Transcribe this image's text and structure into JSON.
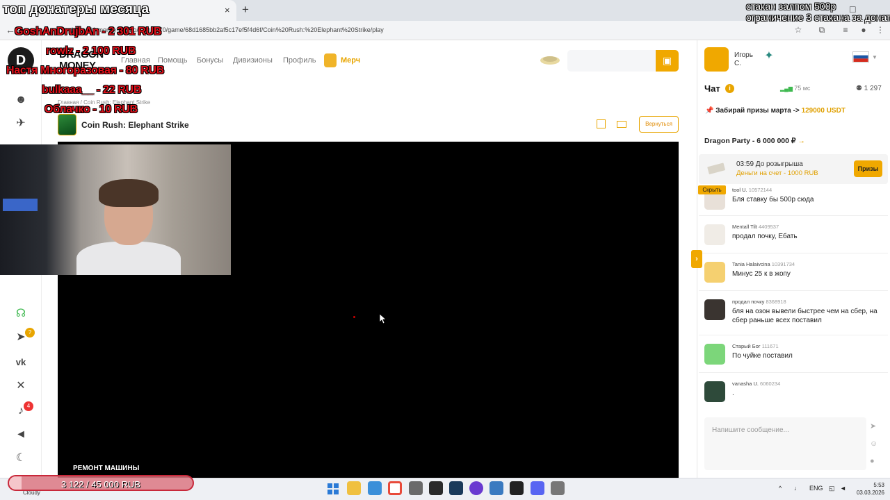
{
  "browser": {
    "new_tab_symbol": "+",
    "close_symbol": "×",
    "url": "dragon21.money-casino/games/70/game/68d1685bb2af5c17ef5f4d6f/Coin%20Rush:%20Elephant%20Strike/play",
    "window_controls": [
      "–",
      "□",
      "×"
    ]
  },
  "site": {
    "logo_text": "DRAGON\nMONEY",
    "nav": [
      "Главная",
      "Помощь",
      "Бонусы",
      "Дивизионы",
      "Профиль"
    ],
    "merch_label": "Мерч",
    "breadcrumb": "Главная / Coin Rush: Elephant Strike",
    "game_title": "Coin Rush: Elephant Strike",
    "return_label": "Вернуться",
    "notification_count": "4",
    "telegram_badge": "?"
  },
  "chat": {
    "user_name": "Игорь\nС.",
    "title": "Чат",
    "ping": "75 мс",
    "online": "1 297",
    "promo_text": "Забирай призы марта ->",
    "promo_amount": "129000 USDT",
    "party": "Dragon Party - 6 000 000 ₽",
    "raffle_time": "03:59 До розыгрыша",
    "raffle_sub": "Деньги на счет - 1000 RUB",
    "prizes_label": "Призы",
    "hide_label": "Скрыть",
    "input_placeholder": "Напишите сообщение...",
    "messages": [
      {
        "name": "tool U.",
        "uid": "10572144",
        "text": "Бля ставку бы 500р сюда",
        "color": "#e8e0d8"
      },
      {
        "name": "Mentall Tilt",
        "uid": "4409537",
        "text": "продал почку, Ебать",
        "color": "#f0ece6"
      },
      {
        "name": "Tania Halaivcina",
        "uid": "10391734",
        "text": "Минус 25 к в жопу",
        "color": "#f5d070"
      },
      {
        "name": "продал почку",
        "uid": "8368918",
        "text": "бля на озон вывели быстрее чем на сбер, на сбер раньше всех поставил",
        "color": "#3a3430"
      },
      {
        "name": "Старый Бог",
        "uid": "111671",
        "text": "По чуйке поставил",
        "color": "#7cd67a"
      },
      {
        "name": "vanasha U.",
        "uid": "6060234",
        "text": ".",
        "color": "#2e4a3a"
      }
    ]
  },
  "overlay": {
    "title": "топ донатеры месяца",
    "rule_line1": "стакан залпом 500р",
    "rule_line2": "ограничение 3 стакана за донат",
    "donors": [
      "GoshAnDrujbAn - 2 301 RUB",
      "rowlz - 2 100 RUB",
      "Настя Многоразовая - 80 RUB",
      "bulkaaa__ - 22 RUB",
      "Облачко - 10 RUB"
    ],
    "repair_label": "РЕМОНТ МАШИНЫ",
    "goal_text": "3 122 / 45 000 RUB",
    "goal_fraction": 0.069
  },
  "taskbar": {
    "weather": "Cloudy",
    "lang": "ENG",
    "time": "5:53",
    "date": "03.03.2026"
  }
}
